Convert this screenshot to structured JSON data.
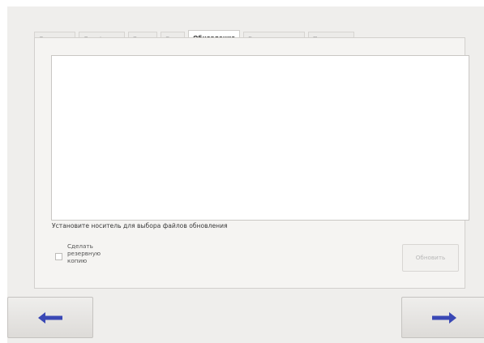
{
  "tabs": [
    {
      "label": "Основные",
      "active": false
    },
    {
      "label": "Дата/время",
      "active": false
    },
    {
      "label": "Экран",
      "active": false
    },
    {
      "label": "Сеть",
      "active": false
    },
    {
      "label": "Обновление",
      "active": true
    },
    {
      "label": "Восстановление",
      "active": false
    },
    {
      "label": "Перезапуск",
      "active": false
    }
  ],
  "update": {
    "hint_text": "Установите носитель для выбора файлов обновления",
    "backup_checkbox_label": "Сделать резервную копию",
    "backup_checked": false,
    "update_button_label": "Обновить",
    "update_button_enabled": false
  },
  "navigation": {
    "back_icon": "arrow-left-icon",
    "next_icon": "arrow-right-icon",
    "arrow_color": "#3a48b5"
  }
}
